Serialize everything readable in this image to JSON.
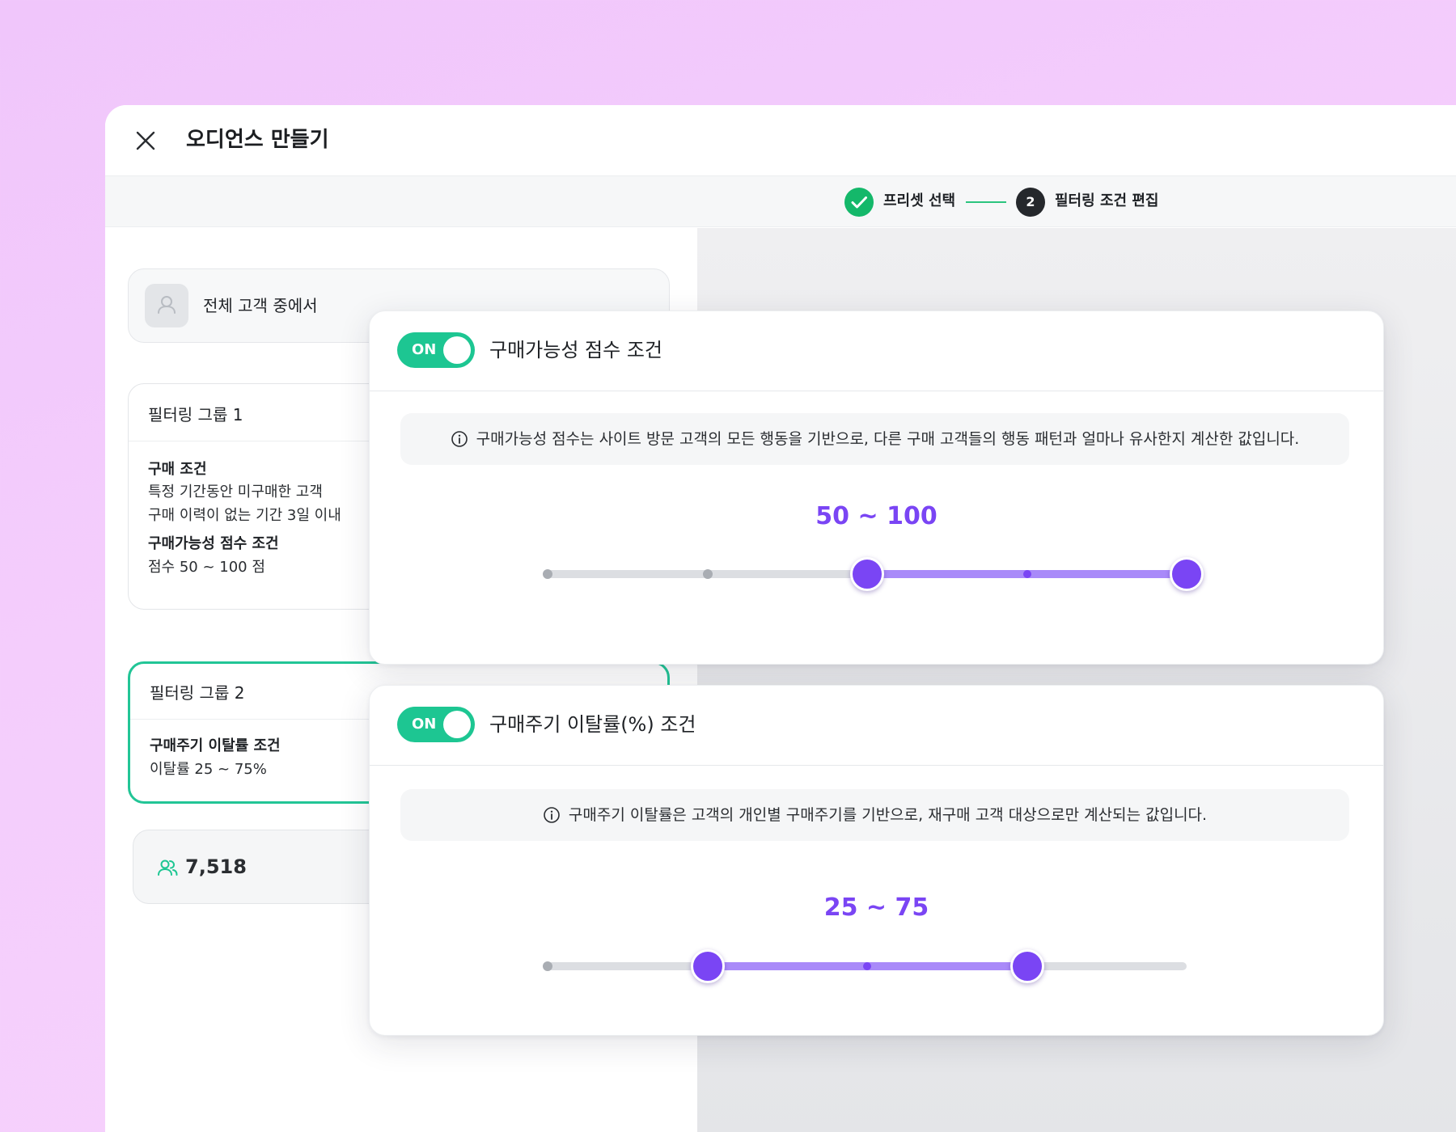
{
  "window": {
    "title": "오디언스 만들기"
  },
  "steps": [
    {
      "label": "프리셋 선택",
      "status": "done"
    },
    {
      "number": "2",
      "label": "필터링 조건 편집",
      "status": "current"
    }
  ],
  "audience": {
    "label": "전체 고객 중에서"
  },
  "groups": [
    {
      "title": "필터링 그룹 1",
      "conditions": [
        {
          "title": "구매 조건",
          "lines": [
            "특정 기간동안 미구매한 고객",
            "구매 이력이 없는 기간 3일 이내"
          ]
        },
        {
          "title": "구매가능성 점수 조건",
          "lines": [
            "점수 50 ~ 100 점"
          ]
        }
      ]
    },
    {
      "title": "필터링 그룹 2",
      "conditions": [
        {
          "title": "구매주기 이탈률 조건",
          "lines": [
            "이탈률 25 ~ 75%"
          ]
        }
      ]
    }
  ],
  "count": {
    "value": "7,518"
  },
  "panels": [
    {
      "toggle": "ON",
      "title": "구매가능성 점수 조건",
      "info": "구매가능성 점수는 사이트 방문 고객의 모든 행동을 기반으로, 다른 구매 고객들의 행동 패턴과 얼마나 유사한지 계산한 값입니다.",
      "range_label": "50 ~ 100",
      "slider": {
        "min": 0,
        "max": 100,
        "low": 50,
        "high": 100,
        "ticks": [
          0,
          25,
          75
        ]
      }
    },
    {
      "toggle": "ON",
      "title": "구매주기 이탈률(%) 조건",
      "info": "구매주기 이탈률은 고객의 개인별 구매주기를 기반으로, 재구매 고객 대상으로만 계산되는 값입니다.",
      "range_label": "25 ~ 75",
      "slider": {
        "min": 0,
        "max": 100,
        "low": 25,
        "high": 75,
        "ticks": [
          0,
          50
        ]
      }
    }
  ],
  "colors": {
    "accent": "#7a45f4",
    "accent_light": "#a98af9",
    "toggle_on": "#1dc692",
    "success": "#14b86a"
  },
  "icons": {
    "close": "close-icon",
    "check": "check-icon",
    "user": "user-icon",
    "info": "info-icon",
    "users": "users-icon"
  }
}
